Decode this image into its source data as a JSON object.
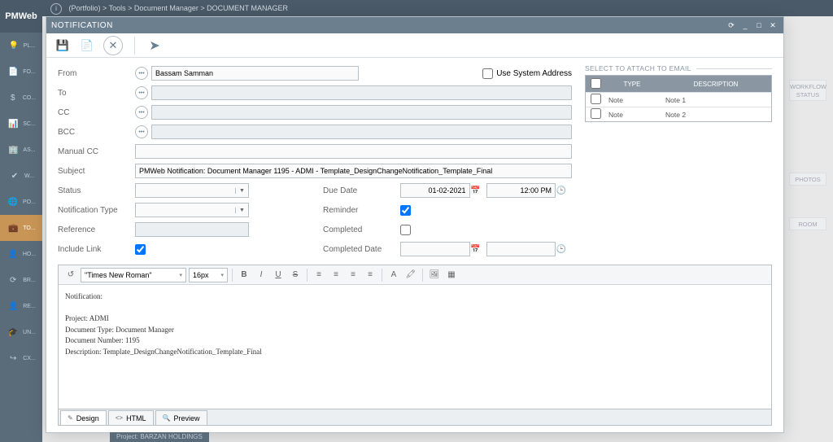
{
  "logo": "PMWeb",
  "breadcrumb": "(Portfolio) > Tools > Document Manager > DOCUMENT MANAGER",
  "sidebar": {
    "items": [
      {
        "icon": "💡",
        "label": "PL..."
      },
      {
        "icon": "📄",
        "label": "FO..."
      },
      {
        "icon": "$",
        "label": "CO..."
      },
      {
        "icon": "📊",
        "label": "SC..."
      },
      {
        "icon": "🏢",
        "label": "AS..."
      },
      {
        "icon": "✔",
        "label": "W..."
      },
      {
        "icon": "🌐",
        "label": "PO..."
      },
      {
        "icon": "💼",
        "label": "TO..."
      },
      {
        "icon": "👤",
        "label": "HO..."
      },
      {
        "icon": "⟳",
        "label": "BR..."
      },
      {
        "icon": "👤",
        "label": "RE..."
      },
      {
        "icon": "🎓",
        "label": "UN..."
      },
      {
        "icon": "↪",
        "label": "CX..."
      }
    ]
  },
  "modal": {
    "title": "NOTIFICATION",
    "fields": {
      "from_label": "From",
      "from_value": "Bassam Samman",
      "to_label": "To",
      "to_value": "",
      "cc_label": "CC",
      "cc_value": "",
      "bcc_label": "BCC",
      "bcc_value": "",
      "manualcc_label": "Manual CC",
      "manualcc_value": "",
      "subject_label": "Subject",
      "subject_value": "PMWeb Notification: Document Manager 1195 - ADMI - Template_DesignChangeNotification_Template_Final",
      "status_label": "Status",
      "status_value": "",
      "duedate_label": "Due Date",
      "duedate_value": "01-02-2021",
      "duetime_value": "12:00 PM",
      "noti_type_label": "Notification Type",
      "noti_type_value": "",
      "reminder_label": "Reminder",
      "reference_label": "Reference",
      "reference_value": "",
      "completed_label": "Completed",
      "includelink_label": "Include Link",
      "compdate_label": "Completed Date",
      "use_system_label": "Use System Address"
    },
    "attach": {
      "header": "SELECT TO ATTACH TO EMAIL",
      "cols": {
        "type": "TYPE",
        "desc": "DESCRIPTION"
      },
      "rows": [
        {
          "type": "Note",
          "desc": "Note 1"
        },
        {
          "type": "Note",
          "desc": "Note 2"
        }
      ]
    },
    "editor": {
      "font_family": "\"Times New Roman\"",
      "font_size": "16px",
      "content_lines": [
        "Notification:",
        "",
        "Project: ADMI",
        "Document Type: Document Manager",
        "Document Number: 1195",
        "Description: Template_DesignChangeNotification_Template_Final"
      ],
      "tabs": {
        "design": "Design",
        "html": "HTML",
        "preview": "Preview"
      }
    }
  },
  "footer_status": "Project: BARZAN HOLDINGS",
  "right_hints": {
    "workflow": "WORKFLOW STATUS",
    "photos": "PHOTOS",
    "room": "ROOM"
  }
}
